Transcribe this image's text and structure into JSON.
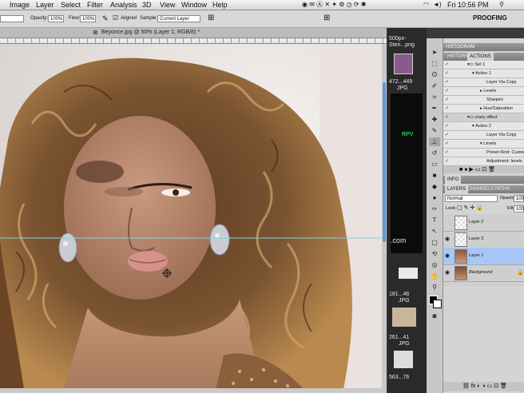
{
  "menubar": {
    "items": [
      "Image",
      "Layer",
      "Select",
      "Filter",
      "Analysis",
      "3D",
      "View",
      "Window",
      "Help"
    ],
    "clock": "Fri 10:56 PM"
  },
  "options": {
    "opacity_label": "Opacity:",
    "opacity_value": "100%",
    "flow_label": "Flow:",
    "flow_value": "100%",
    "aligned_label": "Aligned",
    "sample_label": "Sample:",
    "sample_value": "Current Layer",
    "workspace": "PROOFING"
  },
  "document": {
    "tab_title": "Beyonce.jpg @ 50% (Layer 1, RGB/8) *"
  },
  "strip": {
    "labels": [
      "500px-",
      "Sten...png",
      "472...449",
      "JPG",
      "RPV",
      ".com",
      "181...46",
      "JPG",
      "261...41",
      "JPG",
      "563...76"
    ]
  },
  "history": {
    "tabs": [
      "HISTORY",
      "ACTIONS"
    ],
    "rows": [
      "Set 1",
      "Action 1",
      "Layer Via Copy",
      "Levels",
      "Sharpen",
      "Hue/Saturation",
      "crazy affect",
      "Action 2",
      "Layer Via Copy",
      "Levels",
      "Preset Kind: Custom",
      "Adjustment: levels ..."
    ]
  },
  "info": {
    "tab": "INFO"
  },
  "layers": {
    "tabs": [
      "LAYERS",
      "CHANNELS",
      "PATHS"
    ],
    "blend_mode": "Normal",
    "opacity_label": "Opacity:",
    "opacity_value": "100%",
    "lock_label": "Lock:",
    "fill_label": "Fill:",
    "fill_value": "100%",
    "items": [
      "Layer 2",
      "Layer 3",
      "Layer 1",
      "Background"
    ]
  },
  "colors": {
    "selected_layer": "#a8c6f5",
    "panel_header": "#7c7c7c"
  }
}
